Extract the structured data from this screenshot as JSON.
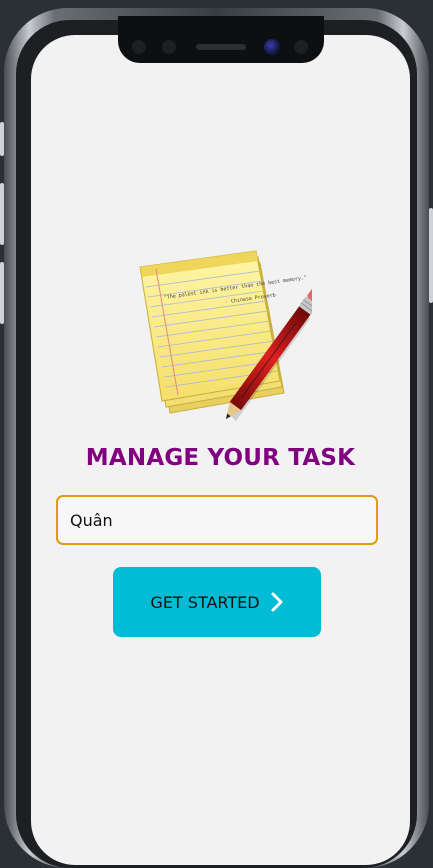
{
  "app": {
    "title": "MANAGE YOUR TASK",
    "logo_icon": "notepad-pencil-icon"
  },
  "name_field": {
    "value": "Quân",
    "placeholder": ""
  },
  "start_button": {
    "label": "GET STARTED",
    "icon": "chevron-right-icon"
  },
  "notepad": {
    "quote": "\"The palest ink is better than the best memory.\"",
    "quote_author": "- Chinese Proverb"
  },
  "colors": {
    "title": "#800080",
    "button": "#00bcd4",
    "input_border": "#e09a14",
    "background": "#f2f2f2"
  }
}
